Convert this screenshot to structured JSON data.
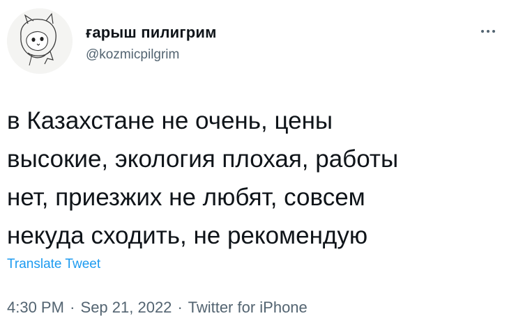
{
  "tweet": {
    "author": {
      "display_name": "ғарыш пилигрим",
      "handle": "@kozmicpilgrim",
      "avatar_icon": "sketch-cat-avatar-icon"
    },
    "more_icon": "more-horizontal-icon",
    "text": "в Казахстане не очень, цены\nвысокие, экология плохая, работы\nнет, приезжих не любят, совсем\nнекуда сходить, не рекомендую",
    "translate_label": "Translate Tweet",
    "time": "4:30 PM",
    "date": "Sep 21, 2022",
    "source": "Twitter for iPhone",
    "separator": "·"
  },
  "colors": {
    "text_primary": "#0f1419",
    "text_secondary": "#536471",
    "link": "#1d9bf0"
  }
}
